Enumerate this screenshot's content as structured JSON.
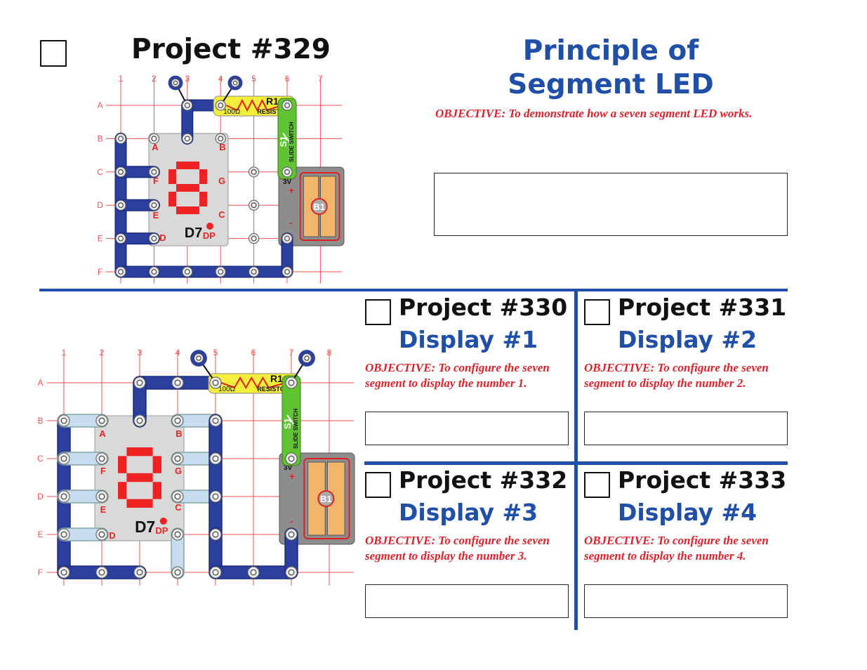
{
  "main_project": {
    "title": "Project #329",
    "heading_line1": "Principle of",
    "heading_line2": "Segment LED",
    "objective": "OBJECTIVE:  To demonstrate how a seven segment LED works."
  },
  "sub_projects": [
    {
      "title": "Project #330",
      "subtitle": "Display #1",
      "objective_line1": "OBJECTIVE:  To configure the seven",
      "objective_line2": "segment to display the number 1."
    },
    {
      "title": "Project #331",
      "subtitle": "Display #2",
      "objective_line1": "OBJECTIVE:  To configure the seven",
      "objective_line2": "segment to display the number 2."
    },
    {
      "title": "Project #332",
      "subtitle": "Display #3",
      "objective_line1": "OBJECTIVE:  To configure the seven",
      "objective_line2": "segment to display the number 3."
    },
    {
      "title": "Project #333",
      "subtitle": "Display #4",
      "objective_line1": "OBJECTIVE:  To configure the seven",
      "objective_line2": "segment to display the number 4."
    }
  ],
  "circuit_labels": {
    "columns_top": [
      "1",
      "2",
      "3",
      "4",
      "5",
      "6",
      "7"
    ],
    "columns_bottom": [
      "1",
      "2",
      "3",
      "4",
      "5",
      "6",
      "7",
      "8"
    ],
    "rows": [
      "A",
      "B",
      "C",
      "D",
      "E",
      "F"
    ],
    "led": "D7",
    "dp": "DP",
    "segments": [
      "A",
      "B",
      "C",
      "D",
      "E",
      "F",
      "G"
    ],
    "resistor": "R1",
    "resistance": "100Ω",
    "resistor_name": "RESISTOR",
    "switch_name": "SLIDE SWITCH",
    "switch_id": "S1",
    "battery": "B1",
    "voltage": "3V",
    "plus": "+",
    "minus": "-"
  },
  "colors": {
    "accent_blue": "#1f4fa8",
    "objective_red": "#e0202a",
    "grid_red": "#f05050",
    "wire_blue": "#2b3f9e",
    "jumper_light_blue": "#c8dcef",
    "resistor_yellow": "#f3ef3a",
    "switch_green": "#5fc332",
    "battery_grey": "#8d8d8d",
    "battery_orange": "#f2b66a"
  }
}
